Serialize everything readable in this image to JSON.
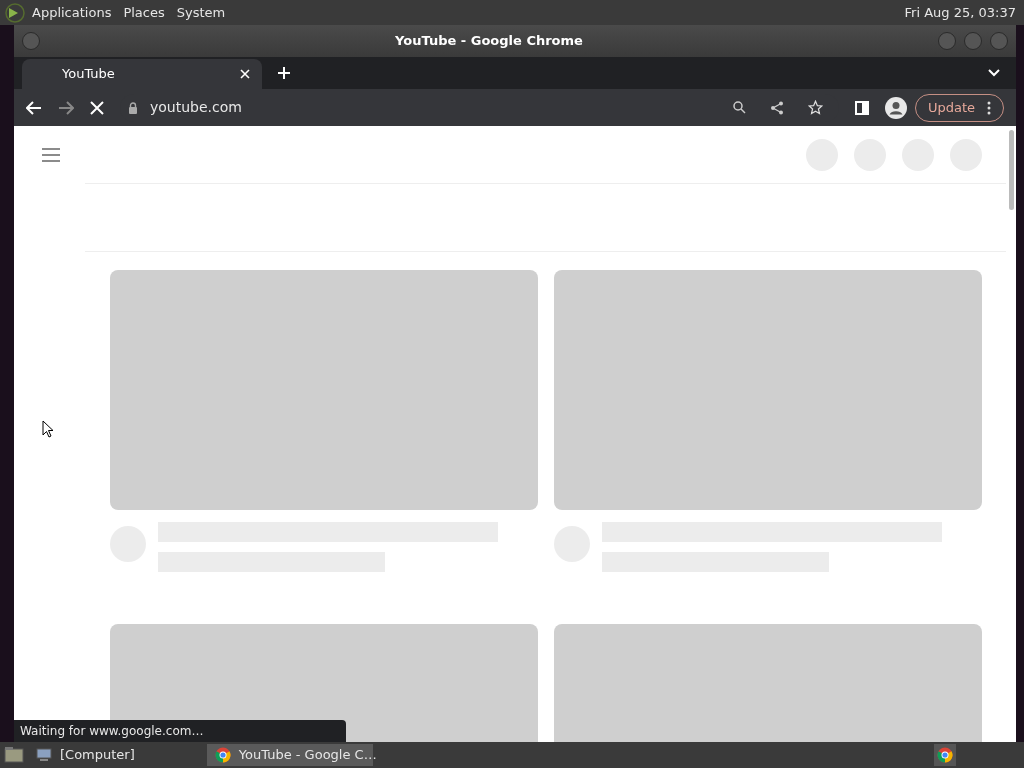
{
  "top_panel": {
    "menus": [
      "Applications",
      "Places",
      "System"
    ],
    "clock": "Fri Aug 25, 03:37"
  },
  "window": {
    "title": "YouTube - Google Chrome"
  },
  "tabs": [
    {
      "label": "YouTube",
      "selected": true
    }
  ],
  "toolbar": {
    "loading": true,
    "address": "youtube.com",
    "update_button": "Update"
  },
  "status_bubble": "Waiting for www.google.com…",
  "taskbar": [
    {
      "label": "[Computer]",
      "selected": false
    },
    {
      "label": "YouTube - Google C…",
      "selected": true
    }
  ]
}
